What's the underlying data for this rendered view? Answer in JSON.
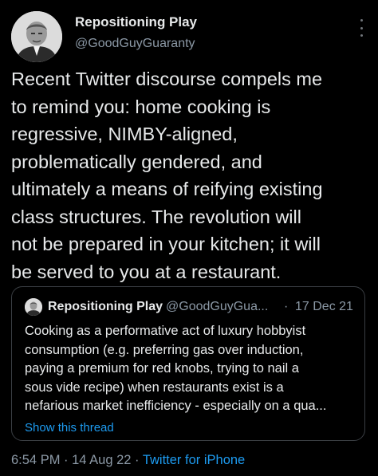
{
  "author": {
    "display_name": "Repositioning Play",
    "handle": "@GoodGuyGuaranty",
    "avatar_icon": "person-portrait-avatar"
  },
  "more_icon": "vertical-ellipsis-icon",
  "tweet": {
    "lines": [
      "Recent Twitter discourse compels me",
      "to remind you: home cooking is",
      "regressive, NIMBY-aligned,",
      "problematically gendered, and",
      "ultimately a means of reifying existing",
      "class structures. The revolution will",
      "not be prepared in your kitchen; it will",
      "be served to you at a restaurant."
    ]
  },
  "quoted_tweet": {
    "display_name": "Repositioning Play",
    "handle": "@GoodGuyGua...",
    "separator": "·",
    "date": "17 Dec 21",
    "lines": [
      "Cooking as a performative act of luxury hobbyist",
      "consumption (e.g. preferring gas over induction,",
      "paying a premium for red knobs, trying to nail a",
      "sous vide recipe) when restaurants exist is a",
      "nefarious market inefficiency - especially on a qua..."
    ],
    "show_thread": "Show this thread"
  },
  "meta": {
    "time": "6:54 PM",
    "sep1": " · ",
    "date": "14 Aug 22",
    "sep2": " · ",
    "source": "Twitter for iPhone"
  },
  "colors": {
    "background": "#000000",
    "text": "#e7e9ea",
    "secondary": "#8b98a5",
    "link": "#1d9bf0",
    "border": "#3a3e43"
  }
}
